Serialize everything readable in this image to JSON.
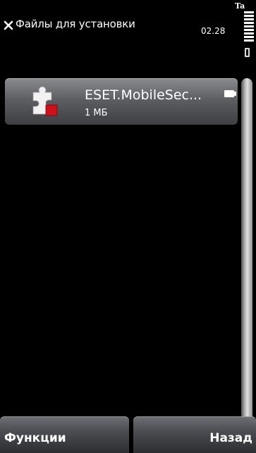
{
  "titlebar": {
    "title": "Файлы для установки",
    "time": "02.28",
    "operator": "Ta"
  },
  "list": {
    "items": [
      {
        "name": "ESET.MobileSec...",
        "size": "1 МБ"
      }
    ]
  },
  "softkeys": {
    "left": "Функции",
    "right": "Назад"
  },
  "colors": {
    "background": "#000000",
    "item_gradient_top": "#8a8b8f",
    "item_gradient_bottom": "#3d3e42",
    "icon_red": "#d0101a",
    "icon_white": "#ffffff"
  },
  "icons": [
    "close-icon",
    "puzzle-icon",
    "memory-card-icon",
    "battery-icon",
    "signal-icon"
  ]
}
